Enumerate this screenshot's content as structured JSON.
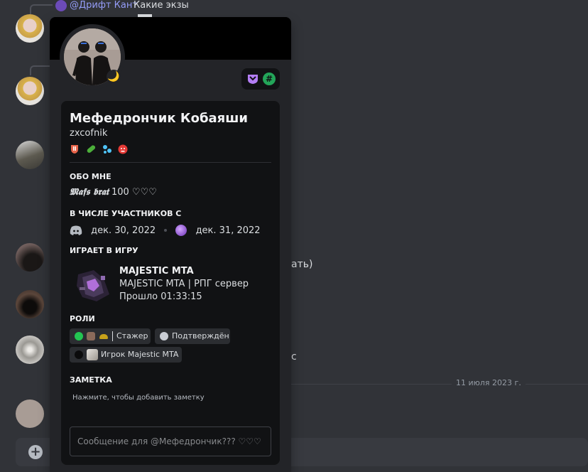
{
  "chat": {
    "reply_mention": "@Дрифт Кант",
    "reply_text": "Какие экзы",
    "fragment_1": "ать)",
    "fragment_2": "с",
    "date_separator": "11 июля 2023 г."
  },
  "popout": {
    "display_name": "Мефедрончик Кобаяши",
    "username": "zxcofnik",
    "status_icon": "moon-icon",
    "about_me": {
      "heading": "ОБО МНЕ",
      "gothic": "𝕸𝖆𝖋𝖘 𝖇𝖗𝖆𝖙",
      "text": " 100 ♡♡♡"
    },
    "member_since": {
      "heading": "В ЧИСЛЕ УЧАСТНИКОВ С",
      "discord_date": "дек. 30, 2022",
      "server_date": "дек. 31, 2022"
    },
    "activity": {
      "heading": "ИГРАЕТ В ИГРУ",
      "title": "MAJESTIC MTA",
      "details": "MAJESTIC MTA | РПГ сервер",
      "elapsed": "Прошло 01:33:15"
    },
    "roles": {
      "heading": "РОЛИ",
      "items": [
        {
          "label": "Стажер",
          "color": "#23c552"
        },
        {
          "label": "Подтверждён",
          "color": "#c9cdd4"
        },
        {
          "label": "Игрок Majestic MTA",
          "color": "#0b0b0c"
        }
      ]
    },
    "note": {
      "heading": "ЗАМЕТКА",
      "placeholder": "Нажмите, чтобы добавить заметку"
    },
    "message": {
      "placeholder": "Сообщение для @Мефедрончик??? ♡♡♡"
    }
  },
  "colors": {
    "background": "#313338",
    "popout": "#232428",
    "popout_inner": "#111214",
    "online_green": "#23a559",
    "idle_yellow": "#f0b232",
    "mention": "#949cf7"
  }
}
